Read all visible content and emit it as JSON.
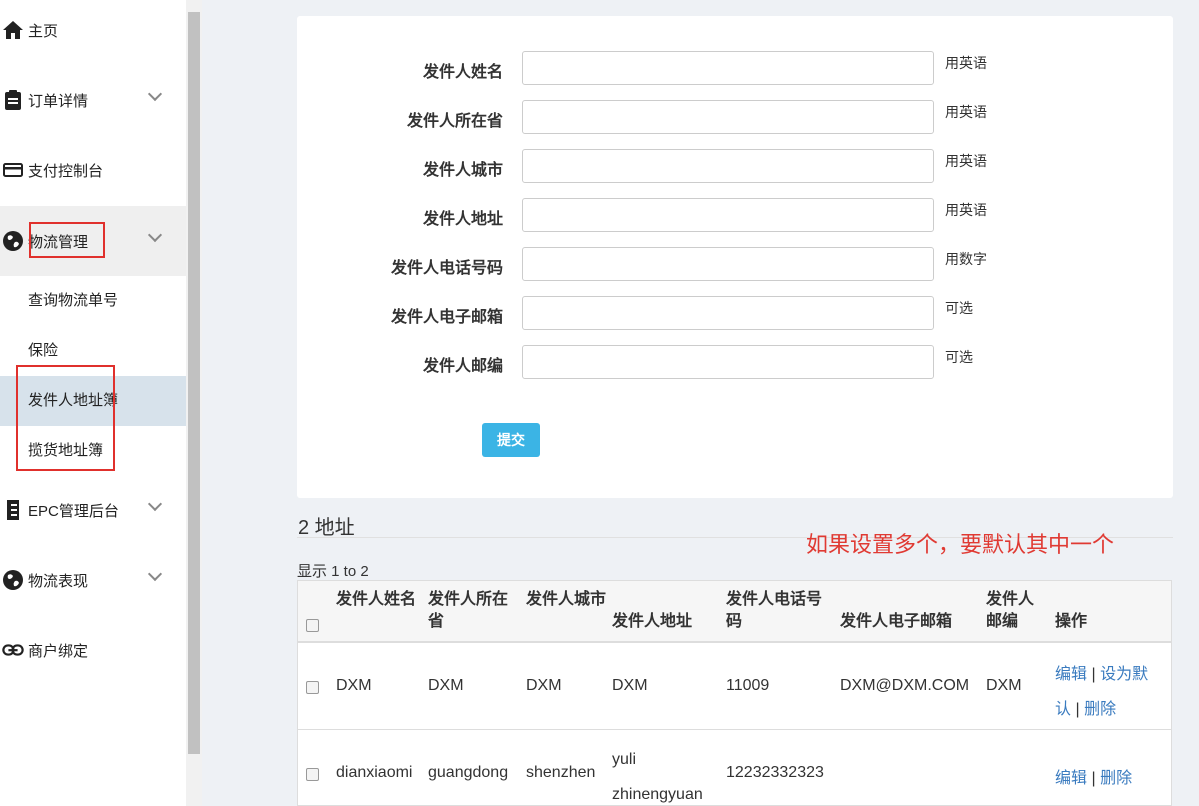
{
  "sidebar": {
    "items": [
      {
        "label": "主页",
        "icon": "home-icon"
      },
      {
        "label": "订单详情",
        "icon": "clipboard-icon"
      },
      {
        "label": "支付控制台",
        "icon": "credit-card-icon"
      },
      {
        "label": "物流管理",
        "icon": "globe-icon"
      },
      {
        "label": "EPC管理后台",
        "icon": "epc-icon"
      },
      {
        "label": "物流表现",
        "icon": "globe-icon"
      },
      {
        "label": "商户绑定",
        "icon": "link-icon"
      }
    ],
    "subitems": [
      {
        "label": "查询物流单号"
      },
      {
        "label": "保险"
      },
      {
        "label": "发件人地址簿"
      },
      {
        "label": "揽货地址簿"
      }
    ]
  },
  "form": {
    "fields": [
      {
        "label": "发件人姓名",
        "hint": "用英语",
        "value": ""
      },
      {
        "label": "发件人所在省",
        "hint": "用英语",
        "value": ""
      },
      {
        "label": "发件人城市",
        "hint": "用英语",
        "value": ""
      },
      {
        "label": "发件人地址",
        "hint": "用英语",
        "value": ""
      },
      {
        "label": "发件人电话号码",
        "hint": "用数字",
        "value": ""
      },
      {
        "label": "发件人电子邮箱",
        "hint": "可选",
        "value": ""
      },
      {
        "label": "发件人邮编",
        "hint": "可选",
        "value": ""
      }
    ],
    "submit_label": "提交"
  },
  "addresses": {
    "title": "2 地址",
    "annotation": "如果设置多个，要默认其中一个",
    "showing": "显示 1 to 2",
    "headers": [
      "发件人姓名",
      "发件人所在省",
      "发件人城市",
      "发件人地址",
      "发件人电话号码",
      "发件人电子邮箱",
      "发件人邮编",
      "操作"
    ],
    "rows": [
      {
        "name": "DXM",
        "province": "DXM",
        "city": "DXM",
        "address": "DXM",
        "phone": "11009",
        "email": "DXM@DXM.COM",
        "zip": "DXM",
        "edit": "编辑",
        "set_default": "设为默认",
        "delete": "删除"
      },
      {
        "name": "dianxiaomi",
        "province": "guangdong",
        "city": "shenzhen",
        "address": "yuli zhinengyuan",
        "phone": "12232332323",
        "email": "",
        "zip": "",
        "edit": "编辑",
        "delete": "删除"
      }
    ]
  },
  "colors": {
    "accent": "#3bb4e5",
    "link": "#3a7bbf",
    "annotation": "#e03a33",
    "highlight_box": "#e0302c"
  }
}
